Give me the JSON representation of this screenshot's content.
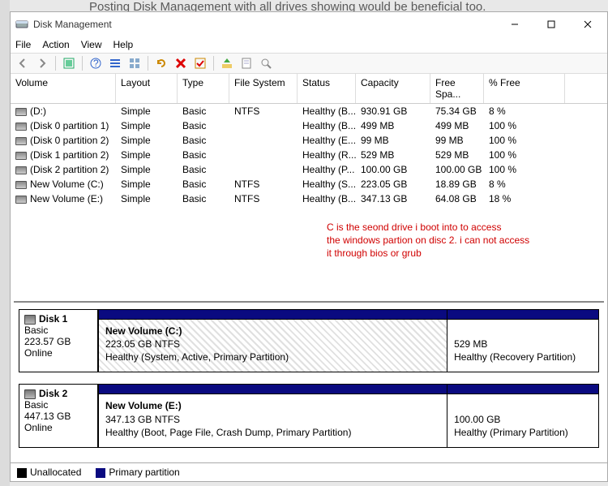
{
  "bg_hint": "Posting Disk Management with all drives showing would be beneficial too.",
  "window": {
    "title": "Disk Management",
    "menus": {
      "file": "File",
      "action": "Action",
      "view": "View",
      "help": "Help"
    }
  },
  "columns": {
    "volume": "Volume",
    "layout": "Layout",
    "type": "Type",
    "fs": "File System",
    "status": "Status",
    "capacity": "Capacity",
    "free": "Free Spa...",
    "pct": "% Free"
  },
  "volumes": [
    {
      "name": "(D:)",
      "layout": "Simple",
      "type": "Basic",
      "fs": "NTFS",
      "status": "Healthy (B...",
      "cap": "930.91 GB",
      "free": "75.34 GB",
      "pct": "8 %"
    },
    {
      "name": "(Disk 0 partition 1)",
      "layout": "Simple",
      "type": "Basic",
      "fs": "",
      "status": "Healthy (B...",
      "cap": "499 MB",
      "free": "499 MB",
      "pct": "100 %"
    },
    {
      "name": "(Disk 0 partition 2)",
      "layout": "Simple",
      "type": "Basic",
      "fs": "",
      "status": "Healthy (E...",
      "cap": "99 MB",
      "free": "99 MB",
      "pct": "100 %"
    },
    {
      "name": "(Disk 1 partition 2)",
      "layout": "Simple",
      "type": "Basic",
      "fs": "",
      "status": "Healthy (R...",
      "cap": "529 MB",
      "free": "529 MB",
      "pct": "100 %"
    },
    {
      "name": "(Disk 2 partition 2)",
      "layout": "Simple",
      "type": "Basic",
      "fs": "",
      "status": "Healthy (P...",
      "cap": "100.00 GB",
      "free": "100.00 GB",
      "pct": "100 %"
    },
    {
      "name": "New Volume (C:)",
      "layout": "Simple",
      "type": "Basic",
      "fs": "NTFS",
      "status": "Healthy (S...",
      "cap": "223.05 GB",
      "free": "18.89 GB",
      "pct": "8 %"
    },
    {
      "name": "New Volume (E:)",
      "layout": "Simple",
      "type": "Basic",
      "fs": "NTFS",
      "status": "Healthy (B...",
      "cap": "347.13 GB",
      "free": "64.08 GB",
      "pct": "18 %"
    }
  ],
  "annotation": {
    "l1": "C is the seond drive i boot into to access",
    "l2": "the windows partion on disc 2. i can not access",
    "l3": "it through bios or grub"
  },
  "disks": {
    "d1": {
      "name": "Disk 1",
      "type": "Basic",
      "size": "223.57 GB",
      "state": "Online",
      "p1": {
        "title": "New Volume  (C:)",
        "sub": "223.05 GB NTFS",
        "status": "Healthy (System, Active, Primary Partition)"
      },
      "p2": {
        "title": "",
        "sub": "529 MB",
        "status": "Healthy (Recovery Partition)"
      }
    },
    "d2": {
      "name": "Disk 2",
      "type": "Basic",
      "size": "447.13 GB",
      "state": "Online",
      "p1": {
        "title": "New Volume  (E:)",
        "sub": "347.13 GB NTFS",
        "status": "Healthy (Boot, Page File, Crash Dump, Primary Partition)"
      },
      "p2": {
        "title": "",
        "sub": "100.00 GB",
        "status": "Healthy (Primary Partition)"
      }
    }
  },
  "legend": {
    "unallocated": "Unallocated",
    "primary": "Primary partition"
  }
}
